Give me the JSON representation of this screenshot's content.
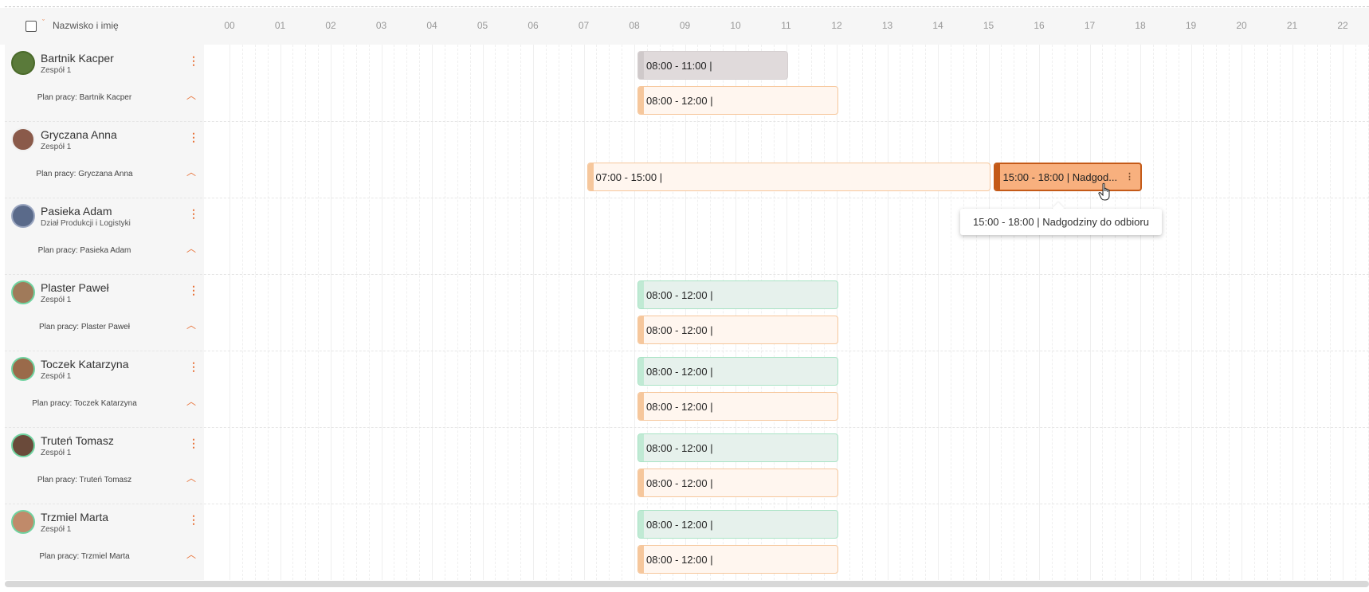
{
  "header": {
    "column_label": "Nazwisko i imię",
    "hours": [
      "00",
      "01",
      "02",
      "03",
      "04",
      "05",
      "06",
      "07",
      "08",
      "09",
      "10",
      "11",
      "12",
      "13",
      "14",
      "15",
      "16",
      "17",
      "18",
      "19",
      "20",
      "21",
      "22"
    ]
  },
  "employees": [
    {
      "name": "Bartnik Kacper",
      "team": "Zespół 1",
      "plan_label": "Plan pracy: Bartnik Kacper",
      "avatar_color": "#5a7a3a",
      "avatar_ring": "#4a6a2a",
      "shifts": [
        {
          "row": "top",
          "text": "08:00 - 11:00 |",
          "kind": "past"
        },
        {
          "row": "plan",
          "text": "08:00 - 12:00 |",
          "kind": "plan"
        }
      ]
    },
    {
      "name": "Gryczana Anna",
      "team": "Zespół 1",
      "plan_label": "Plan pracy: Gryczana Anna",
      "avatar_color": "#8a5a4a",
      "avatar_ring": "#f0f0f0",
      "shifts": [
        {
          "row": "plan",
          "text": "07:00 - 15:00 |",
          "kind": "plan"
        },
        {
          "row": "plan",
          "text": "15:00 - 18:00 | Nadgod...",
          "kind": "ot"
        }
      ]
    },
    {
      "name": "Pasieka Adam",
      "team": "Dział Produkcji i Logistyki",
      "plan_label": "Plan pracy: Pasieka Adam",
      "avatar_color": "#5a6a8a",
      "avatar_ring": "#9aa6c0",
      "shifts": []
    },
    {
      "name": "Plaster Paweł",
      "team": "Zespół 1",
      "plan_label": "Plan pracy: Plaster Paweł",
      "avatar_color": "#a07a5a",
      "avatar_ring": "#6fd3a0",
      "shifts": [
        {
          "row": "top",
          "text": "08:00 - 12:00 |",
          "kind": "done"
        },
        {
          "row": "plan",
          "text": "08:00 - 12:00 |",
          "kind": "plan"
        }
      ]
    },
    {
      "name": "Toczek Katarzyna",
      "team": "Zespół 1",
      "plan_label": "Plan pracy: Toczek Katarzyna",
      "avatar_color": "#9a6a4a",
      "avatar_ring": "#6fd3a0",
      "shifts": [
        {
          "row": "top",
          "text": "08:00 - 12:00 |",
          "kind": "done"
        },
        {
          "row": "plan",
          "text": "08:00 - 12:00 |",
          "kind": "plan"
        }
      ]
    },
    {
      "name": "Truteń Tomasz",
      "team": "Zespół 1",
      "plan_label": "Plan pracy: Truteń Tomasz",
      "avatar_color": "#6a4a3a",
      "avatar_ring": "#6fd3a0",
      "shifts": [
        {
          "row": "top",
          "text": "08:00 - 12:00 |",
          "kind": "done"
        },
        {
          "row": "plan",
          "text": "08:00 - 12:00 |",
          "kind": "plan"
        }
      ]
    },
    {
      "name": "Trzmiel Marta",
      "team": "Zespół 1",
      "plan_label": "Plan pracy: Trzmiel Marta",
      "avatar_color": "#c08a6a",
      "avatar_ring": "#6fd3a0",
      "shifts": [
        {
          "row": "top",
          "text": "08:00 - 12:00 |",
          "kind": "done"
        },
        {
          "row": "plan",
          "text": "08:00 - 12:00 |",
          "kind": "plan"
        }
      ]
    }
  ],
  "tooltip": {
    "text": "15:00 - 18:00 | Nadgodziny do odbioru"
  },
  "colors": {
    "accent": "#e8733a",
    "overtime": "#c45a18",
    "done": "#a9e3c5",
    "plan": "#f6c79c"
  }
}
